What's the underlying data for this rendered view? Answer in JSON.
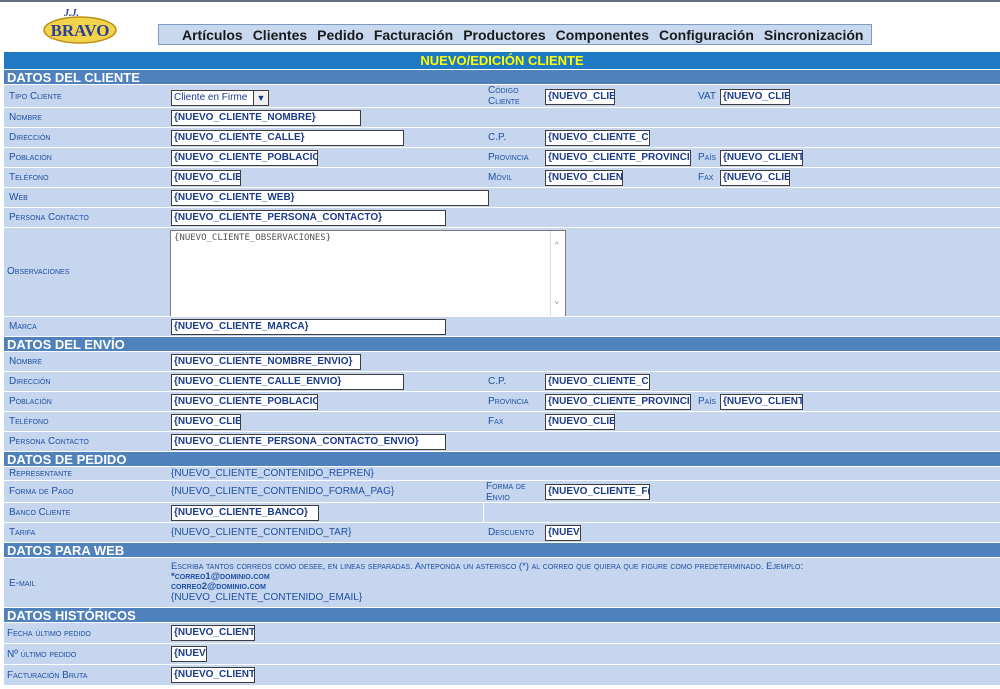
{
  "logo": {
    "text_top": "J.J.",
    "text_main": "BRAVO"
  },
  "menu": [
    "Artículos",
    "Clientes",
    "Pedido",
    "Facturación",
    "Productores",
    "Componentes",
    "Configuración",
    "Sincronización"
  ],
  "page_title": "NUEVO/EDICIÓN CLIENTE",
  "sections": {
    "cliente": "DATOS DEL CLIENTE",
    "envio": "DATOS DEL ENVÍO",
    "pedido": "DATOS DE PEDIDO",
    "web": "DATOS PARA WEB",
    "historicos": "DATOS HISTÓRICOS"
  },
  "cliente": {
    "tipo_label": "Tipo Cliente",
    "tipo_value": "Cliente en Firme",
    "codigo_label_1": "Código",
    "codigo_label_2": "Cliente",
    "codigo_value": "{NUEVO_CLIE",
    "vat_label": "VAT",
    "vat_value": "{NUEVO_CLIE",
    "nombre_label": "Nombre",
    "nombre_value": "{NUEVO_CLIENTE_NOMBRE}",
    "direccion_label": "Dirección",
    "direccion_value": "{NUEVO_CLIENTE_CALLE}",
    "cp_label": "C.P.",
    "cp_value": "{NUEVO_CLIENTE_C",
    "poblacion_label": "Población",
    "poblacion_value": "{NUEVO_CLIENTE_POBLACIO",
    "provincia_label": "Provincia",
    "provincia_value": "{NUEVO_CLIENTE_PROVINCI/",
    "pais_label": "País",
    "pais_value": "{NUEVO_CLIENT",
    "telefono_label": "Teléfono",
    "telefono_value": "{NUEVO_CLIE",
    "movil_label": "Móvil",
    "movil_value": "{NUEVO_CLIEN",
    "fax_label": "Fax",
    "fax_value": "{NUEVO_CLIE",
    "web_label": "Web",
    "web_value": "{NUEVO_CLIENTE_WEB}",
    "contacto_label": "Persona Contacto",
    "contacto_value": "{NUEVO_CLIENTE_PERSONA_CONTACTO}",
    "observaciones_label": "Observaciones",
    "observaciones_value": "{NUEVO_CLIENTE_OBSERVACIONES}",
    "marca_label": "Marca",
    "marca_value": "{NUEVO_CLIENTE_MARCA}"
  },
  "envio": {
    "nombre_label": "Nombre",
    "nombre_value": "{NUEVO_CLIENTE_NOMBRE_ENVIO}",
    "direccion_label": "Dirección",
    "direccion_value": "{NUEVO_CLIENTE_CALLE_ENVIO}",
    "cp_label": "C.P.",
    "cp_value": "{NUEVO_CLIENTE_C",
    "poblacion_label": "Población",
    "poblacion_value": "{NUEVO_CLIENTE_POBLACIO",
    "provincia_label": "Provincia",
    "provincia_value": "{NUEVO_CLIENTE_PROVINCI/",
    "pais_label": "País",
    "pais_value": "{NUEVO_CLIENT",
    "telefono_label": "Teléfono",
    "telefono_value": "{NUEVO_CLIE",
    "fax_label": "Fax",
    "fax_value": "{NUEVO_CLIE",
    "contacto_label": "Persona Contacto",
    "contacto_value": "{NUEVO_CLIENTE_PERSONA_CONTACTO_ENVIO}"
  },
  "pedido": {
    "representante_label": "Representante",
    "representante_value": "{NUEVO_CLIENTE_CONTENIDO_REPREN}",
    "forma_pago_label": "Forma de Pago",
    "forma_pago_value": "{NUEVO_CLIENTE_CONTENIDO_FORMA_PAG}",
    "forma_envio_label_1": "Forma de",
    "forma_envio_label_2": "Envio",
    "forma_envio_value": "{NUEVO_CLIENTE_F(",
    "banco_label": "Banco Cliente",
    "banco_value": "{NUEVO_CLIENTE_BANCO}",
    "tarifa_label": "Tarifa",
    "tarifa_value": "{NUEVO_CLIENTE_CONTENIDO_TAR}",
    "descuento_label": "Descuento",
    "descuento_value": "{NUEV"
  },
  "web": {
    "email_label": "E-mail",
    "instructions": "Escriba tantos correos como desee, en lineas separadas. Anteponga un asterisco (*) al correo que quiera que figure como predeterminado. Ejemplo:",
    "example_1": "*correo1@dominio.com",
    "example_2": "correo2@dominio.com",
    "email_value": "{NUEVO_CLIENTE_CONTENIDO_EMAIL}"
  },
  "historicos": {
    "fecha_label": "Fecha último pedido",
    "fecha_value": "{NUEVO_CLIENT",
    "numero_label": "Nº último pedido",
    "numero_value": "{NUEV",
    "facturacion_label": "Facturación Bruta",
    "facturacion_value": "{NUEVO_CLIENT"
  }
}
